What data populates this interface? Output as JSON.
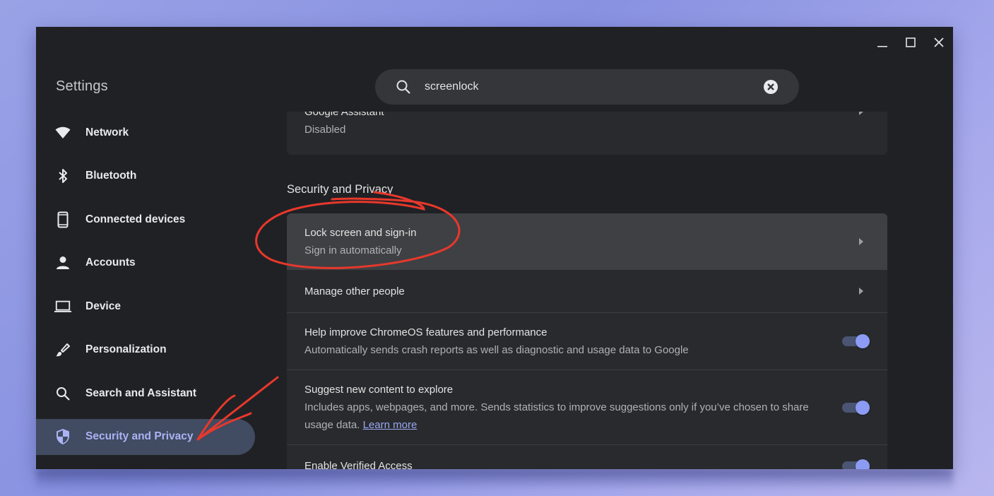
{
  "window": {
    "title": "Settings",
    "controls": [
      "minimize",
      "maximize",
      "close"
    ]
  },
  "search": {
    "value": "screenlock",
    "placeholder": "Search settings"
  },
  "sidebar": {
    "items": [
      {
        "label": "Network",
        "icon": "wifi-icon",
        "active": false
      },
      {
        "label": "Bluetooth",
        "icon": "bluetooth-icon",
        "active": false
      },
      {
        "label": "Connected devices",
        "icon": "phone-icon",
        "active": false
      },
      {
        "label": "Accounts",
        "icon": "person-icon",
        "active": false
      },
      {
        "label": "Device",
        "icon": "laptop-icon",
        "active": false
      },
      {
        "label": "Personalization",
        "icon": "brush-icon",
        "active": false
      },
      {
        "label": "Search and Assistant",
        "icon": "search-icon",
        "active": false
      },
      {
        "label": "Security and Privacy",
        "icon": "shield-icon",
        "active": true
      }
    ]
  },
  "content": {
    "assistant_card": {
      "title": "Google Assistant",
      "subtitle": "Disabled"
    },
    "section_title": "Security and Privacy",
    "rows": [
      {
        "title": "Lock screen and sign-in",
        "subtitle": "Sign in automatically",
        "type": "link",
        "highlighted": true
      },
      {
        "title": "Manage other people",
        "subtitle": "",
        "type": "link"
      },
      {
        "title": "Help improve ChromeOS features and performance",
        "subtitle": "Automatically sends crash reports as well as diagnostic and usage data to Google",
        "type": "toggle",
        "enabled": true
      },
      {
        "title": "Suggest new content to explore",
        "subtitle": "Includes apps, webpages, and more. Sends statistics to improve suggestions only if you’ve chosen to share usage data.",
        "link_text": "Learn more",
        "type": "toggle",
        "enabled": true
      },
      {
        "title": "Enable Verified Access",
        "subtitle": "",
        "type": "toggle",
        "enabled": true
      }
    ]
  },
  "colors": {
    "window_bg": "#202124",
    "card_bg": "#292a2d",
    "accent": "#8c9cf5",
    "active_nav_bg": "#414b61",
    "annotation_red": "#e8382c"
  }
}
